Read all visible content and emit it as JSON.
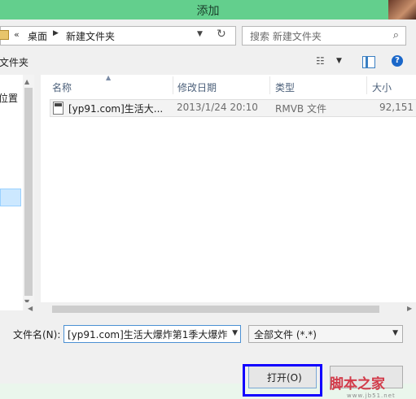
{
  "window": {
    "title": "添加"
  },
  "address": {
    "crumbs": [
      "桌面",
      "新建文件夹"
    ]
  },
  "search": {
    "placeholder": "搜索 新建文件夹"
  },
  "toolbar": {
    "folder_label": "文件夹"
  },
  "nav": {
    "location_label": "位置"
  },
  "columns": [
    "名称",
    "修改日期",
    "类型",
    "大小"
  ],
  "files": [
    {
      "name": "[yp91.com]生活大...",
      "date": "2013/1/24 20:10",
      "type": "RMVB 文件",
      "size": "92,151 k"
    }
  ],
  "footer": {
    "filename_label": "文件名(N):",
    "filename_value": "[yp91.com]生活大爆炸第1季大爆炸",
    "filetype_value": "全部文件 (*.*)",
    "open_label": "打开(O)"
  },
  "watermark": {
    "main": "脚本之家",
    "sub": "www.jb51.net"
  },
  "colors": {
    "titlebar": "#63cf8d",
    "highlight_border": "#1100ff",
    "selection": "#cce8ff"
  },
  "icons": [
    "folder-icon",
    "chevron-right-icon",
    "refresh-icon",
    "search-icon",
    "view-list-icon",
    "preview-pane-icon",
    "help-icon",
    "file-icon"
  ]
}
